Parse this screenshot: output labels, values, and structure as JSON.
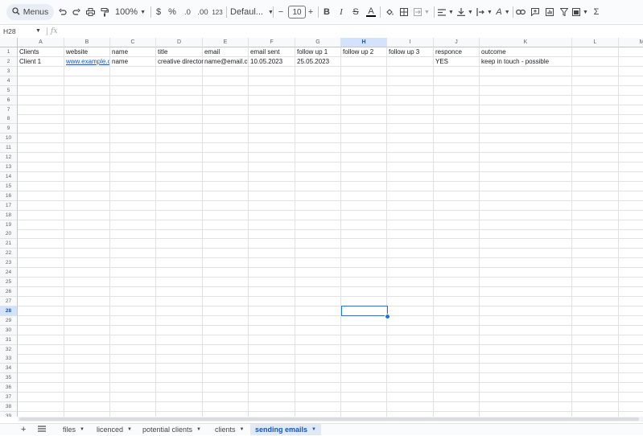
{
  "toolbar": {
    "menus_label": "Menus",
    "zoom": "100%",
    "currency": "$",
    "percent": "%",
    "decrease_decimal": ".0",
    "increase_decimal": ".00",
    "number_format": "123",
    "font_family": "Defaul...",
    "font_size": "10",
    "bold": "B",
    "italic": "I",
    "strike": "S",
    "text_color": "A",
    "text_rotation": "A",
    "sum": "Σ",
    "decrement": "−",
    "increment": "+"
  },
  "formula_bar": {
    "name_box": "H28",
    "fx": "fx",
    "value": ""
  },
  "grid": {
    "columns": [
      "A",
      "B",
      "C",
      "D",
      "E",
      "F",
      "G",
      "H",
      "I",
      "J",
      "K",
      "L",
      "M"
    ],
    "selected_column": "H",
    "row_count": 39,
    "selected_row": 28,
    "rows": [
      [
        "Clients",
        "website",
        "name",
        "title",
        "email",
        "email sent",
        "follow up 1",
        "follow up 2",
        "follow up 3",
        "responce",
        "outcome",
        "",
        ""
      ],
      [
        "Client 1",
        "www.example.co",
        "name",
        "creative director",
        "name@email.co",
        "10.05.2023",
        "25.05.2023",
        "",
        "",
        "YES",
        "keep in touch - possible",
        "",
        ""
      ]
    ]
  },
  "sheet_tabs": [
    {
      "label": "files",
      "active": false
    },
    {
      "label": "licenced",
      "active": false
    },
    {
      "label": "potential clients",
      "active": false
    },
    {
      "label": "clients",
      "active": false
    },
    {
      "label": "sending emails",
      "active": true
    }
  ],
  "colors": {
    "accent": "#1a73e8",
    "link": "#1155cc",
    "active_tab_bg": "#e1e9f7",
    "header_selected_bg": "#d3e3fd"
  }
}
